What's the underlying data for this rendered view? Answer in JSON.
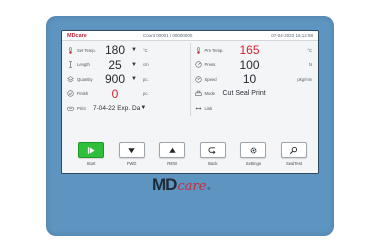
{
  "status": {
    "logo": "MDcare",
    "count": "Count 00001 / 00000000",
    "datetime": "07-04-2022 16:12:58"
  },
  "params_left": [
    {
      "label": "Set Temp.",
      "value": "180",
      "unit": "°C",
      "icon": "thermometer-icon",
      "value_color": "#252b31"
    },
    {
      "label": "Length",
      "value": "25",
      "unit": "cm",
      "icon": "length-icon",
      "value_color": "#252b31"
    },
    {
      "label": "Quantity",
      "value": "900",
      "unit": "pc.",
      "icon": "stack-icon",
      "value_color": "#252b31"
    },
    {
      "label": "Finish",
      "value": "0",
      "unit": "pc.",
      "icon": "check-circle-icon",
      "value_color": "#d81e34"
    }
  ],
  "params_right": [
    {
      "label": "Pre Temp.",
      "value": "165",
      "unit": "°C",
      "icon": "thermometer-icon",
      "value_color": "#d81e34"
    },
    {
      "label": "Press.",
      "value": "100",
      "unit": "N",
      "icon": "gauge-icon"
    },
    {
      "label": "Speed",
      "value": "10",
      "unit": "pkg/min",
      "icon": "speed-icon"
    },
    {
      "label": "Mode",
      "value": "Cut Seal Print",
      "icon": "printer-icon"
    }
  ],
  "print": {
    "label": "Print",
    "value": "7-04-22 Exp. Da",
    "icon": "print-icon"
  },
  "link": {
    "label": "Link",
    "icon": "link-icon"
  },
  "toolbar": [
    {
      "label": "Start",
      "icon": "play-icon"
    },
    {
      "label": "FWD",
      "icon": "down-arrow-icon"
    },
    {
      "label": "REW",
      "icon": "up-arrow-icon"
    },
    {
      "label": "Back",
      "icon": "back-icon"
    },
    {
      "label": "Settings",
      "icon": "gear-icon"
    },
    {
      "label": "SealTest",
      "icon": "search-icon"
    }
  ],
  "brand": {
    "md": "MD",
    "care": "care",
    "tm": "®"
  },
  "colors": {
    "bezel": "#5d94c0",
    "start": "#2fbf3c",
    "alert": "#d81e34"
  }
}
